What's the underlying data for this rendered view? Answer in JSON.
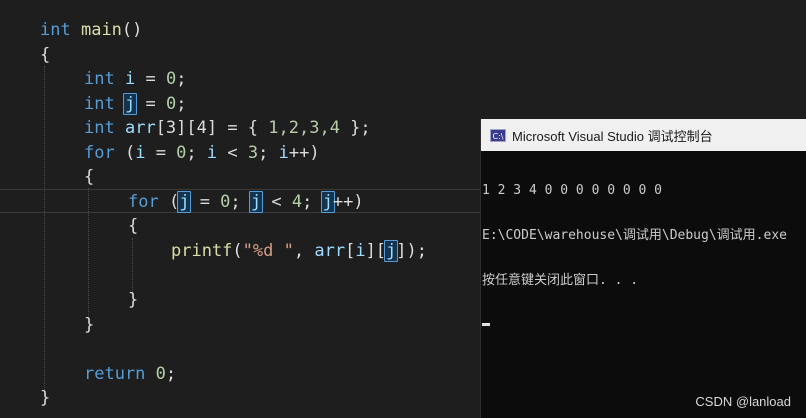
{
  "editor": {
    "code": {
      "l1": {
        "kw": "int",
        "fn": "main",
        "rest": "()"
      },
      "l2": "{",
      "l3": {
        "kw": "int",
        "var": "i",
        "eq": " = ",
        "num": "0",
        "end": ";"
      },
      "l4": {
        "kw": "int",
        "var": "j",
        "eq": " = ",
        "num": "0",
        "end": ";"
      },
      "l5": {
        "kw": "int",
        "var": "arr",
        "rest": "[3][4] = { ",
        "nums": "1,2,3,4",
        "end": " };"
      },
      "l6": {
        "kw": "for",
        "a": " (",
        "v1": "i",
        "b": " = ",
        "n1": "0",
        "c": "; ",
        "v2": "i",
        "d": " < ",
        "n2": "3",
        "e": "; ",
        "v3": "i",
        "f": "++)"
      },
      "l7": "{",
      "l8": {
        "kw": "for",
        "a": " (",
        "v1": "j",
        "b": " = ",
        "n1": "0",
        "c": "; ",
        "v2": "j",
        "d": " < ",
        "n2": "4",
        "e": "; ",
        "v3": "j",
        "f": "++)"
      },
      "l9": "{",
      "l10": {
        "fn": "printf",
        "a": "(",
        "str": "\"%d \"",
        "b": ", ",
        "arr": "arr",
        "c": "[",
        "i": "i",
        "d": "][",
        "j": "j",
        "e": "]);"
      },
      "l11": "}",
      "l12": "}",
      "l13": {
        "kw": "return",
        "num": "0",
        "end": ";"
      },
      "l14": "}"
    }
  },
  "console": {
    "title": "Microsoft Visual Studio 调试控制台",
    "icon": "console-app-icon",
    "icon_text": "C:\\",
    "lines": [
      "1 2 3 4 0 0 0 0 0 0 0 0",
      "E:\\CODE\\warehouse\\调试用\\Debug\\调试用.exe",
      "按任意键关闭此窗口. . ."
    ]
  },
  "watermark": "CSDN @lanload",
  "colors": {
    "background": "#1e1e1e",
    "keyword": "#569cd6",
    "function": "#dcdcaa",
    "variable": "#9cdcfe",
    "number": "#b5cea8",
    "string": "#d69d85",
    "console_bg": "#0c0c0c"
  }
}
